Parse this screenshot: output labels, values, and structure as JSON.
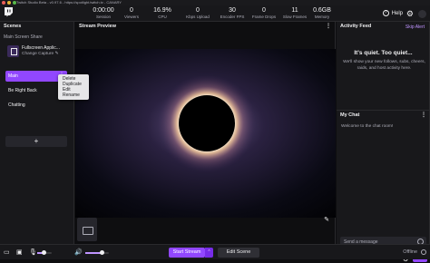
{
  "window": {
    "title": "Twitch Studio Beta - v0.97.6 - https://spotlight.twitch.tv - CANARY"
  },
  "stats": [
    {
      "value": "0:00:00",
      "label": "Session"
    },
    {
      "value": "0",
      "label": "Viewers"
    },
    {
      "value": "16.9%",
      "label": "CPU"
    },
    {
      "value": "0",
      "label": "Kbps Upload"
    },
    {
      "value": "30",
      "label": "Encoder FPS"
    },
    {
      "value": "0",
      "label": "Frame Drops"
    },
    {
      "value": "11",
      "label": "Slow Frames"
    },
    {
      "value": "0.6GB",
      "label": "Memory"
    }
  ],
  "header": {
    "help_label": "Help"
  },
  "scenes": {
    "title": "Scenes",
    "subtitle": "Main Screen Share",
    "source_name": "Fullscreen Applic...",
    "source_action": "Change Capture",
    "items": [
      {
        "label": "Main",
        "active": true
      },
      {
        "label": "Be Right Back",
        "active": false
      },
      {
        "label": "Chatting",
        "active": false
      }
    ],
    "add_label": "+"
  },
  "context_menu": [
    "Delete",
    "Duplicate",
    "Edit",
    "Rename"
  ],
  "preview": {
    "title": "Stream Preview"
  },
  "activity": {
    "title": "Activity Feed",
    "alert_link": "Skip Alert",
    "empty_title": "It's quiet. Too quiet...",
    "empty_subtitle": "We'll show your new follows, subs, cheers, raids, and host activity here."
  },
  "chat": {
    "title": "My Chat",
    "welcome": "Welcome to the chat room!",
    "placeholder": "Send a message",
    "send_label": "Chat"
  },
  "bottom": {
    "start_label": "Start Stream",
    "edit_label": "Edit Scene",
    "status": "Offline",
    "mic_level": 0.45,
    "desktop_level": 0.7
  },
  "colors": {
    "accent": "#9147ff",
    "panel": "#18181b",
    "background": "#0e0e10"
  }
}
